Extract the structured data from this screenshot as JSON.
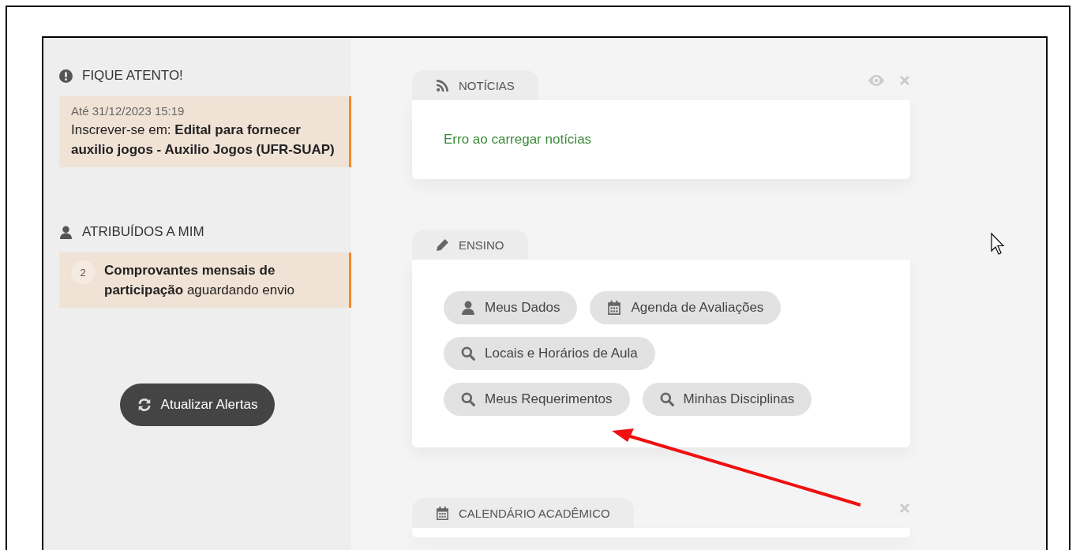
{
  "sidebar": {
    "alerts": {
      "title": "FIQUE ATENTO!",
      "items": [
        {
          "date": "Até 31/12/2023 15:19",
          "text": "Inscrever-se em: **Edital para fornecer auxilio jogos - Auxilio Jogos (UFR-SUAP)**"
        }
      ]
    },
    "assigned": {
      "title": "ATRIBUÍDOS A MIM",
      "items": [
        {
          "count": "2",
          "text": "**Comprovantes mensais de participação** aguardando envio"
        }
      ]
    },
    "refresh_button": "Atualizar Alertas"
  },
  "widgets": [
    {
      "title": "NOTÍCIAS",
      "kind": "rss",
      "actions": [
        {
          "kind": "eye"
        },
        {
          "kind": "close"
        }
      ],
      "message": "Erro ao carregar notícias"
    },
    {
      "title": "ENSINO",
      "kind": "pencil",
      "links": [
        [
          {
            "label": "Meus Dados",
            "kind": "user"
          },
          {
            "label": "Agenda de Avaliações",
            "kind": "calendar"
          }
        ],
        [
          {
            "label": "Locais e Horários de Aula",
            "kind": "search"
          }
        ],
        [
          {
            "label": "Meus Requerimentos",
            "kind": "search"
          },
          {
            "label": "Minhas Disciplinas",
            "kind": "search"
          }
        ]
      ]
    },
    {
      "title": "CALENDÁRIO ACADÊMICO",
      "kind": "calendar",
      "actions": [
        {
          "kind": "close"
        }
      ]
    }
  ]
}
